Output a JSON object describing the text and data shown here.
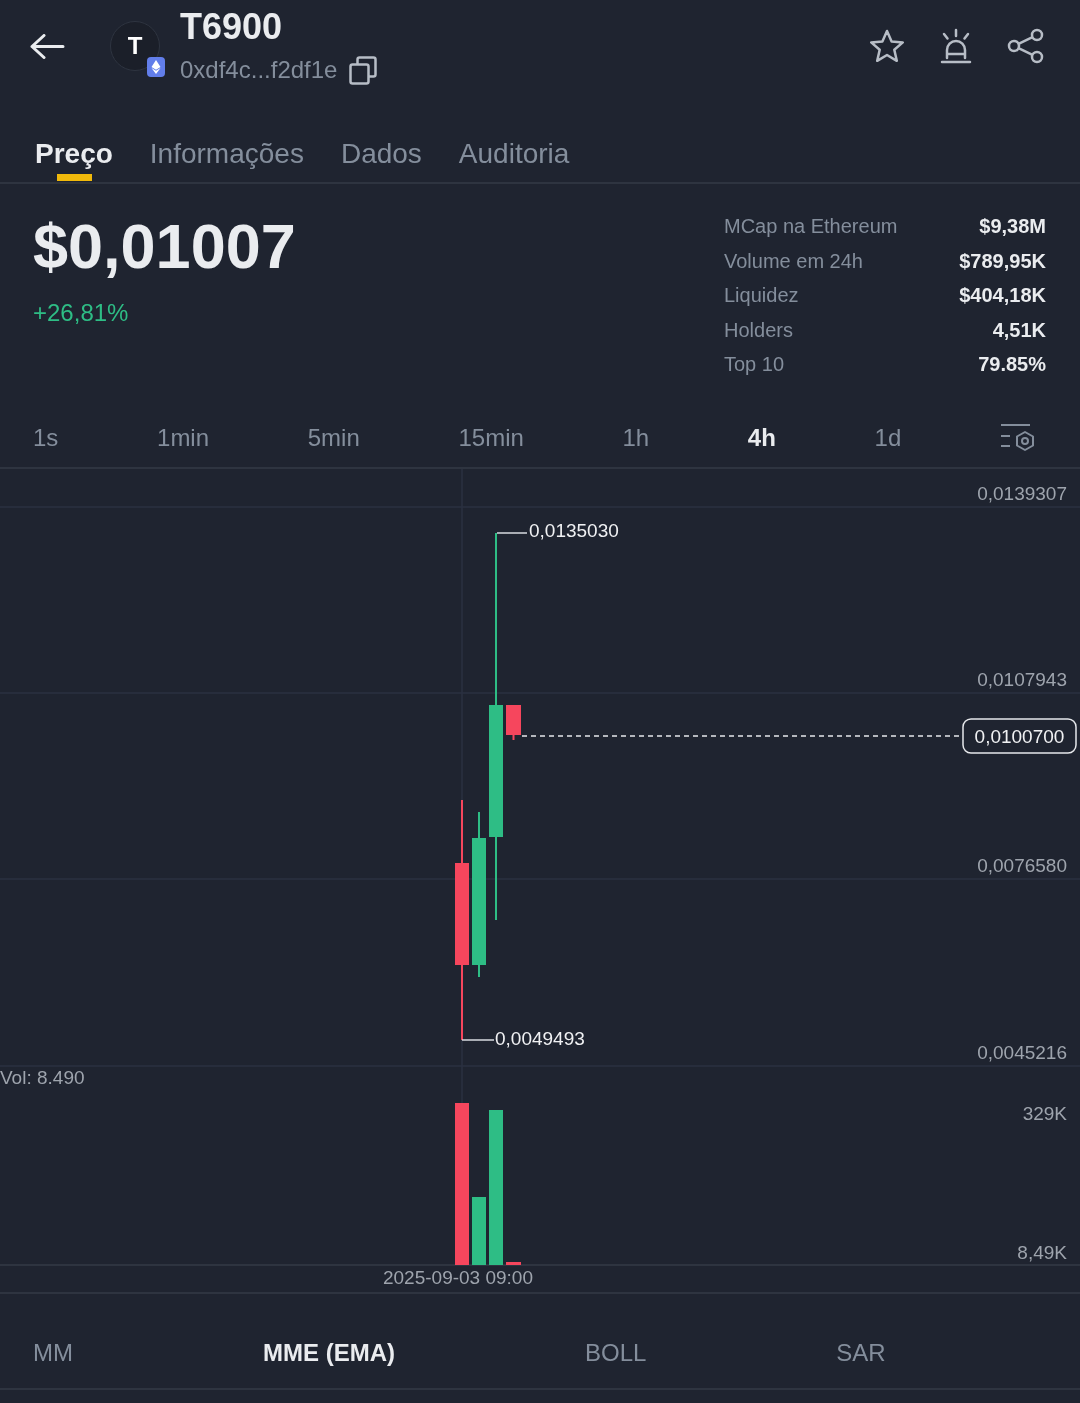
{
  "token": {
    "avatar_letter": "T",
    "name": "T6900",
    "address": "0xdf4c...f2df1e"
  },
  "tabs": [
    {
      "label": "Preço",
      "selected": true
    },
    {
      "label": "Informações",
      "selected": false
    },
    {
      "label": "Dados",
      "selected": false
    },
    {
      "label": "Auditoria",
      "selected": false
    }
  ],
  "price": {
    "value": "$0,01007",
    "change": "+26,81%",
    "rising": true
  },
  "stats": [
    {
      "label": "MCap na Ethereum",
      "value": "$9,38M"
    },
    {
      "label": "Volume em 24h",
      "value": "$789,95K"
    },
    {
      "label": "Liquidez",
      "value": "$404,18K"
    },
    {
      "label": "Holders",
      "value": "4,51K"
    },
    {
      "label": "Top 10",
      "value": "79.85%"
    }
  ],
  "timeframes": [
    {
      "label": "1s",
      "selected": false
    },
    {
      "label": "1min",
      "selected": false
    },
    {
      "label": "5min",
      "selected": false
    },
    {
      "label": "15min",
      "selected": false
    },
    {
      "label": "1h",
      "selected": false
    },
    {
      "label": "4h",
      "selected": true
    },
    {
      "label": "1d",
      "selected": false
    }
  ],
  "chart": {
    "price_axis_labels": [
      "0,0139307",
      "0,0107943",
      "0,0076580",
      "0,0045216"
    ],
    "high_label": "0,0135030",
    "low_label": "0,0049493",
    "current_price": "0,0100700",
    "volume_label": "Vol: 8.490",
    "volume_axis_labels": [
      "329K",
      "8,49K"
    ],
    "time_label": "2025-09-03 09:00"
  },
  "indicators": [
    {
      "label": "MM",
      "selected": false
    },
    {
      "label": "MME (EMA)",
      "selected": true
    },
    {
      "label": "BOLL",
      "selected": false
    },
    {
      "label": "SAR",
      "selected": false
    }
  ]
}
